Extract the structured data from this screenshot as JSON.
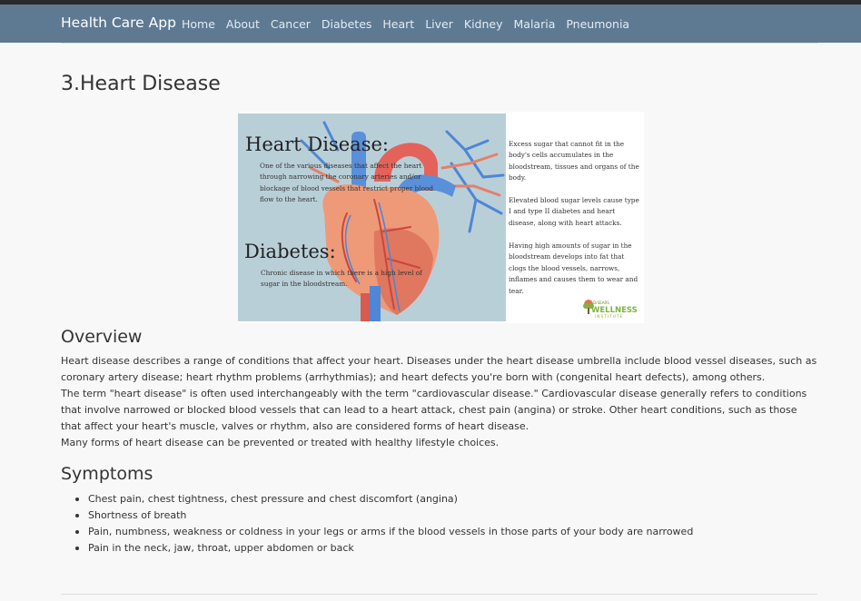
{
  "navbar": {
    "brand": "Health Care App",
    "links": [
      "Home",
      "About",
      "Cancer",
      "Diabetes",
      "Heart",
      "Liver",
      "Kidney",
      "Malaria",
      "Pneumonia"
    ]
  },
  "page": {
    "title": "3.Heart Disease"
  },
  "figure": {
    "heart_title": "Heart Disease:",
    "heart_desc": "One of the various diseases that affect the heart through narrowing the coronary arteries and/or blockage of blood vessels that restrict proper blood flow to the heart.",
    "diabetes_title": "Diabetes:",
    "diabetes_desc": "Chronic disease in which there is a high level of sugar in the bloodstream.",
    "right_p1": "Excess sugar that cannot fit in the body's cells accumulates in the bloodstream, tissues and organs of the body.",
    "right_p2": "Elevated blood sugar levels cause type I and type II diabetes and heart disease, along with heart attacks.",
    "right_p3": "Having high amounts of sugar in the bloodstream develops into fat that clogs the blood vessels, narrows, inflames and causes them to wear and tear.",
    "logo_small": "DrSEARS",
    "logo_big": "WELLNESS",
    "logo_sub": "INSTITUTE"
  },
  "overview": {
    "heading": "Overview",
    "p1": "Heart disease describes a range of conditions that affect your heart. Diseases under the heart disease umbrella include blood vessel diseases, such as coronary artery disease; heart rhythm problems (arrhythmias); and heart defects you're born with (congenital heart defects), among others.",
    "p2": "The term \"heart disease\" is often used interchangeably with the term \"cardiovascular disease.\" Cardiovascular disease generally refers to conditions that involve narrowed or blocked blood vessels that can lead to a heart attack, chest pain (angina) or stroke. Other heart conditions, such as those that affect your heart's muscle, valves or rhythm, also are considered forms of heart disease.",
    "p3": "Many forms of heart disease can be prevented or treated with healthy lifestyle choices."
  },
  "symptoms": {
    "heading": "Symptoms",
    "items": [
      "Chest pain, chest tightness, chest pressure and chest discomfort (angina)",
      "Shortness of breath",
      "Pain, numbness, weakness or coldness in your legs or arms if the blood vessels in those parts of your body are narrowed",
      "Pain in the neck, jaw, throat, upper abdomen or back"
    ]
  },
  "colors": {
    "navbar": "#5e7a93",
    "background": "#f8f8f8",
    "logo_green": "#7fb33f"
  }
}
